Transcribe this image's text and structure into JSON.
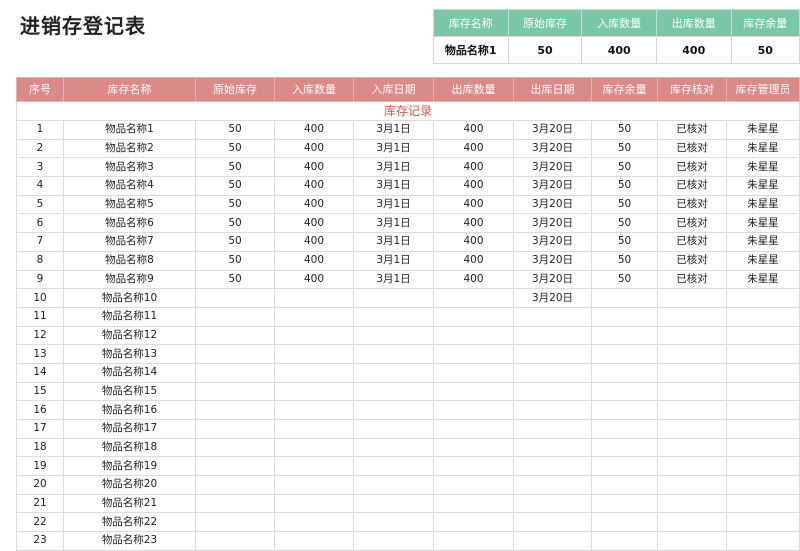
{
  "page": {
    "title": "进销存登记表"
  },
  "summary": {
    "headers": [
      "库存名称",
      "原始库存",
      "入库数量",
      "出库数量",
      "库存余量"
    ],
    "values": [
      "物品名称1",
      "50",
      "400",
      "400",
      "50"
    ],
    "header_color": "#78c8a8"
  },
  "main": {
    "headers": [
      "序号",
      "库存名称",
      "原始库存",
      "入库数量",
      "入库日期",
      "出库数量",
      "出库日期",
      "库存余量",
      "库存核对",
      "库存管理员"
    ],
    "header_color": "#db8a88",
    "section_title": "库存记录",
    "section_color": "#d9534f",
    "rows": [
      [
        "1",
        "物品名称1",
        "50",
        "400",
        "3月1日",
        "400",
        "3月20日",
        "50",
        "已核对",
        "朱星星"
      ],
      [
        "2",
        "物品名称2",
        "50",
        "400",
        "3月1日",
        "400",
        "3月20日",
        "50",
        "已核对",
        "朱星星"
      ],
      [
        "3",
        "物品名称3",
        "50",
        "400",
        "3月1日",
        "400",
        "3月20日",
        "50",
        "已核对",
        "朱星星"
      ],
      [
        "4",
        "物品名称4",
        "50",
        "400",
        "3月1日",
        "400",
        "3月20日",
        "50",
        "已核对",
        "朱星星"
      ],
      [
        "5",
        "物品名称5",
        "50",
        "400",
        "3月1日",
        "400",
        "3月20日",
        "50",
        "已核对",
        "朱星星"
      ],
      [
        "6",
        "物品名称6",
        "50",
        "400",
        "3月1日",
        "400",
        "3月20日",
        "50",
        "已核对",
        "朱星星"
      ],
      [
        "7",
        "物品名称7",
        "50",
        "400",
        "3月1日",
        "400",
        "3月20日",
        "50",
        "已核对",
        "朱星星"
      ],
      [
        "8",
        "物品名称8",
        "50",
        "400",
        "3月1日",
        "400",
        "3月20日",
        "50",
        "已核对",
        "朱星星"
      ],
      [
        "9",
        "物品名称9",
        "50",
        "400",
        "3月1日",
        "400",
        "3月20日",
        "50",
        "已核对",
        "朱星星"
      ],
      [
        "10",
        "物品名称10",
        "",
        "",
        "",
        "",
        "3月20日",
        "",
        "",
        ""
      ],
      [
        "11",
        "物品名称11",
        "",
        "",
        "",
        "",
        "",
        "",
        "",
        ""
      ],
      [
        "12",
        "物品名称12",
        "",
        "",
        "",
        "",
        "",
        "",
        "",
        ""
      ],
      [
        "13",
        "物品名称13",
        "",
        "",
        "",
        "",
        "",
        "",
        "",
        ""
      ],
      [
        "14",
        "物品名称14",
        "",
        "",
        "",
        "",
        "",
        "",
        "",
        ""
      ],
      [
        "15",
        "物品名称15",
        "",
        "",
        "",
        "",
        "",
        "",
        "",
        ""
      ],
      [
        "16",
        "物品名称16",
        "",
        "",
        "",
        "",
        "",
        "",
        "",
        ""
      ],
      [
        "17",
        "物品名称17",
        "",
        "",
        "",
        "",
        "",
        "",
        "",
        ""
      ],
      [
        "18",
        "物品名称18",
        "",
        "",
        "",
        "",
        "",
        "",
        "",
        ""
      ],
      [
        "19",
        "物品名称19",
        "",
        "",
        "",
        "",
        "",
        "",
        "",
        ""
      ],
      [
        "20",
        "物品名称20",
        "",
        "",
        "",
        "",
        "",
        "",
        "",
        ""
      ],
      [
        "21",
        "物品名称21",
        "",
        "",
        "",
        "",
        "",
        "",
        "",
        ""
      ],
      [
        "22",
        "物品名称22",
        "",
        "",
        "",
        "",
        "",
        "",
        "",
        ""
      ],
      [
        "23",
        "物品名称23",
        "",
        "",
        "",
        "",
        "",
        "",
        "",
        ""
      ]
    ]
  }
}
